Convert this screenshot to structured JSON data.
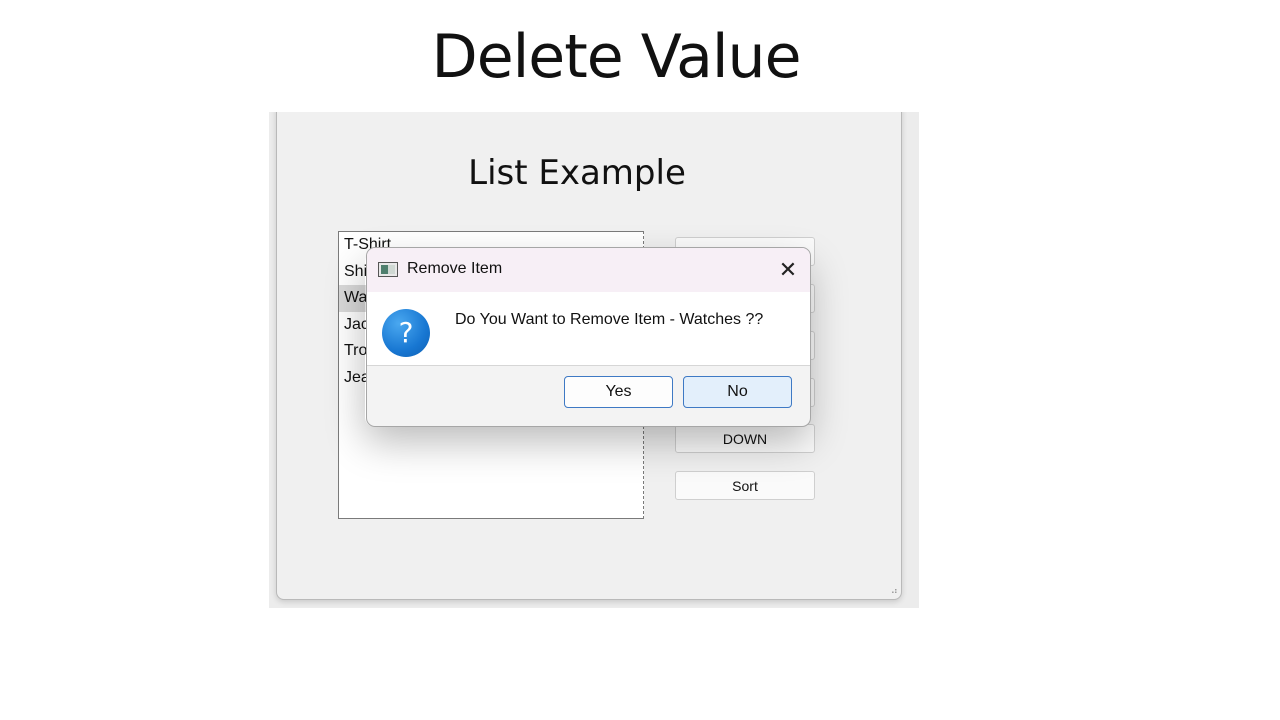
{
  "slide": {
    "title": "Delete Value"
  },
  "app": {
    "title": "List Example",
    "list_items": [
      {
        "label": "T-Shirt"
      },
      {
        "label": "Shi"
      },
      {
        "label": "Wa"
      },
      {
        "label": "Jac"
      },
      {
        "label": "Tro"
      },
      {
        "label": "Jea"
      }
    ],
    "selected_index": 2,
    "buttons": {
      "down_label": "DOWN",
      "sort_label": "Sort"
    },
    "resize_grip_glyph": "⠴"
  },
  "dialog": {
    "title": "Remove Item",
    "close_glyph": "✕",
    "message": "Do You Want to Remove Item - Watches ??",
    "question_glyph": "?",
    "yes_label": "Yes",
    "no_label": "No",
    "colors": {
      "titlebar": "#f7eff6",
      "button_border": "#3e79c4",
      "icon_blue": "#1877d2"
    }
  }
}
